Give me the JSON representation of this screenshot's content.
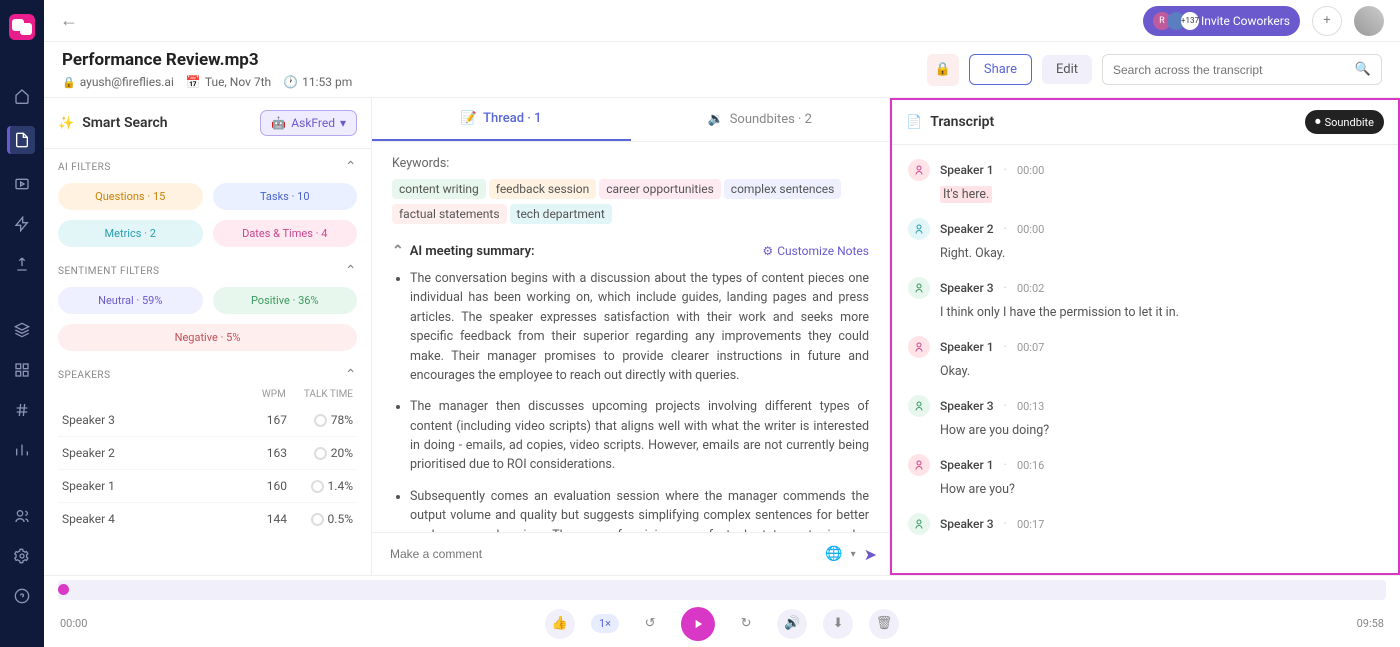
{
  "header": {
    "invite_badge": "+137",
    "invite_label": "Invite Coworkers"
  },
  "meta": {
    "title": "Performance Review.mp3",
    "owner": "ayush@fireflies.ai",
    "date": "Tue, Nov 7th",
    "time": "11:53 pm",
    "share": "Share",
    "edit": "Edit",
    "search_placeholder": "Search across the transcript"
  },
  "sidebar": {
    "title": "Smart Search",
    "askfred": "AskFred",
    "ai_filters_h": "AI FILTERS",
    "filters": {
      "questions": "Questions · 15",
      "tasks": "Tasks · 10",
      "metrics": "Metrics · 2",
      "dates": "Dates & Times · 4"
    },
    "senti_h": "SENTIMENT FILTERS",
    "senti": {
      "neutral": "Neutral · 59%",
      "positive": "Positive · 36%",
      "negative": "Negative · 5%"
    },
    "speakers_h": "SPEAKERS",
    "col_wpm": "WPM",
    "col_talk": "TALK TIME",
    "speakers": [
      {
        "name": "Speaker 3",
        "wpm": "167",
        "pct": "78%"
      },
      {
        "name": "Speaker 2",
        "wpm": "163",
        "pct": "20%"
      },
      {
        "name": "Speaker 1",
        "wpm": "160",
        "pct": "1.4%"
      },
      {
        "name": "Speaker 4",
        "wpm": "144",
        "pct": "0.5%"
      }
    ]
  },
  "center": {
    "tab_thread": "Thread · 1",
    "tab_sound": "Soundbites · 2",
    "kw_label": "Keywords:",
    "kws": [
      "content writing",
      "feedback session",
      "career opportunities",
      "complex sentences",
      "factual statements",
      "tech department"
    ],
    "sum_h": "AI meeting summary:",
    "custom": "Customize Notes",
    "bullets": [
      "The conversation begins with a discussion about the types of content pieces one individual has been working on, which include guides, landing pages and press articles. The speaker expresses satisfaction with their work and seeks more specific feedback from their superior regarding any improvements they could make. Their manager promises to provide clearer instructions in future and encourages the employee to reach out directly with queries.",
      "The manager then discusses upcoming projects involving different types of content (including video scripts) that aligns well with what the writer is interested in doing - emails, ad copies, video scripts. However, emails are not currently being prioritised due to ROI considerations.",
      "Subsequently comes an evaluation session where the manager commends the output volume and quality but suggests simplifying complex sentences for better reader comprehension. The use of opinions as factual statements is also addressed: it should be avoided unless backed by credible sources."
    ],
    "comment_ph": "Make a comment"
  },
  "right": {
    "title": "Transcript",
    "soundbite": "Soundbite",
    "turns": [
      {
        "sp": "Speaker 1",
        "cls": "av-s1",
        "ts": "00:00",
        "txt": "It's here.",
        "hl": true
      },
      {
        "sp": "Speaker 2",
        "cls": "av-s2",
        "ts": "00:00",
        "txt": "Right. Okay."
      },
      {
        "sp": "Speaker 3",
        "cls": "av-s3",
        "ts": "00:02",
        "txt": "I think only I have the permission to let it in."
      },
      {
        "sp": "Speaker 1",
        "cls": "av-s1",
        "ts": "00:07",
        "txt": "Okay."
      },
      {
        "sp": "Speaker 3",
        "cls": "av-s3",
        "ts": "00:13",
        "txt": "How are you doing?"
      },
      {
        "sp": "Speaker 1",
        "cls": "av-s1",
        "ts": "00:16",
        "txt": "How are you?"
      },
      {
        "sp": "Speaker 3",
        "cls": "av-s3",
        "ts": "00:17",
        "txt": ""
      }
    ]
  },
  "player": {
    "cur": "00:00",
    "dur": "09:58",
    "speed": "1×"
  }
}
